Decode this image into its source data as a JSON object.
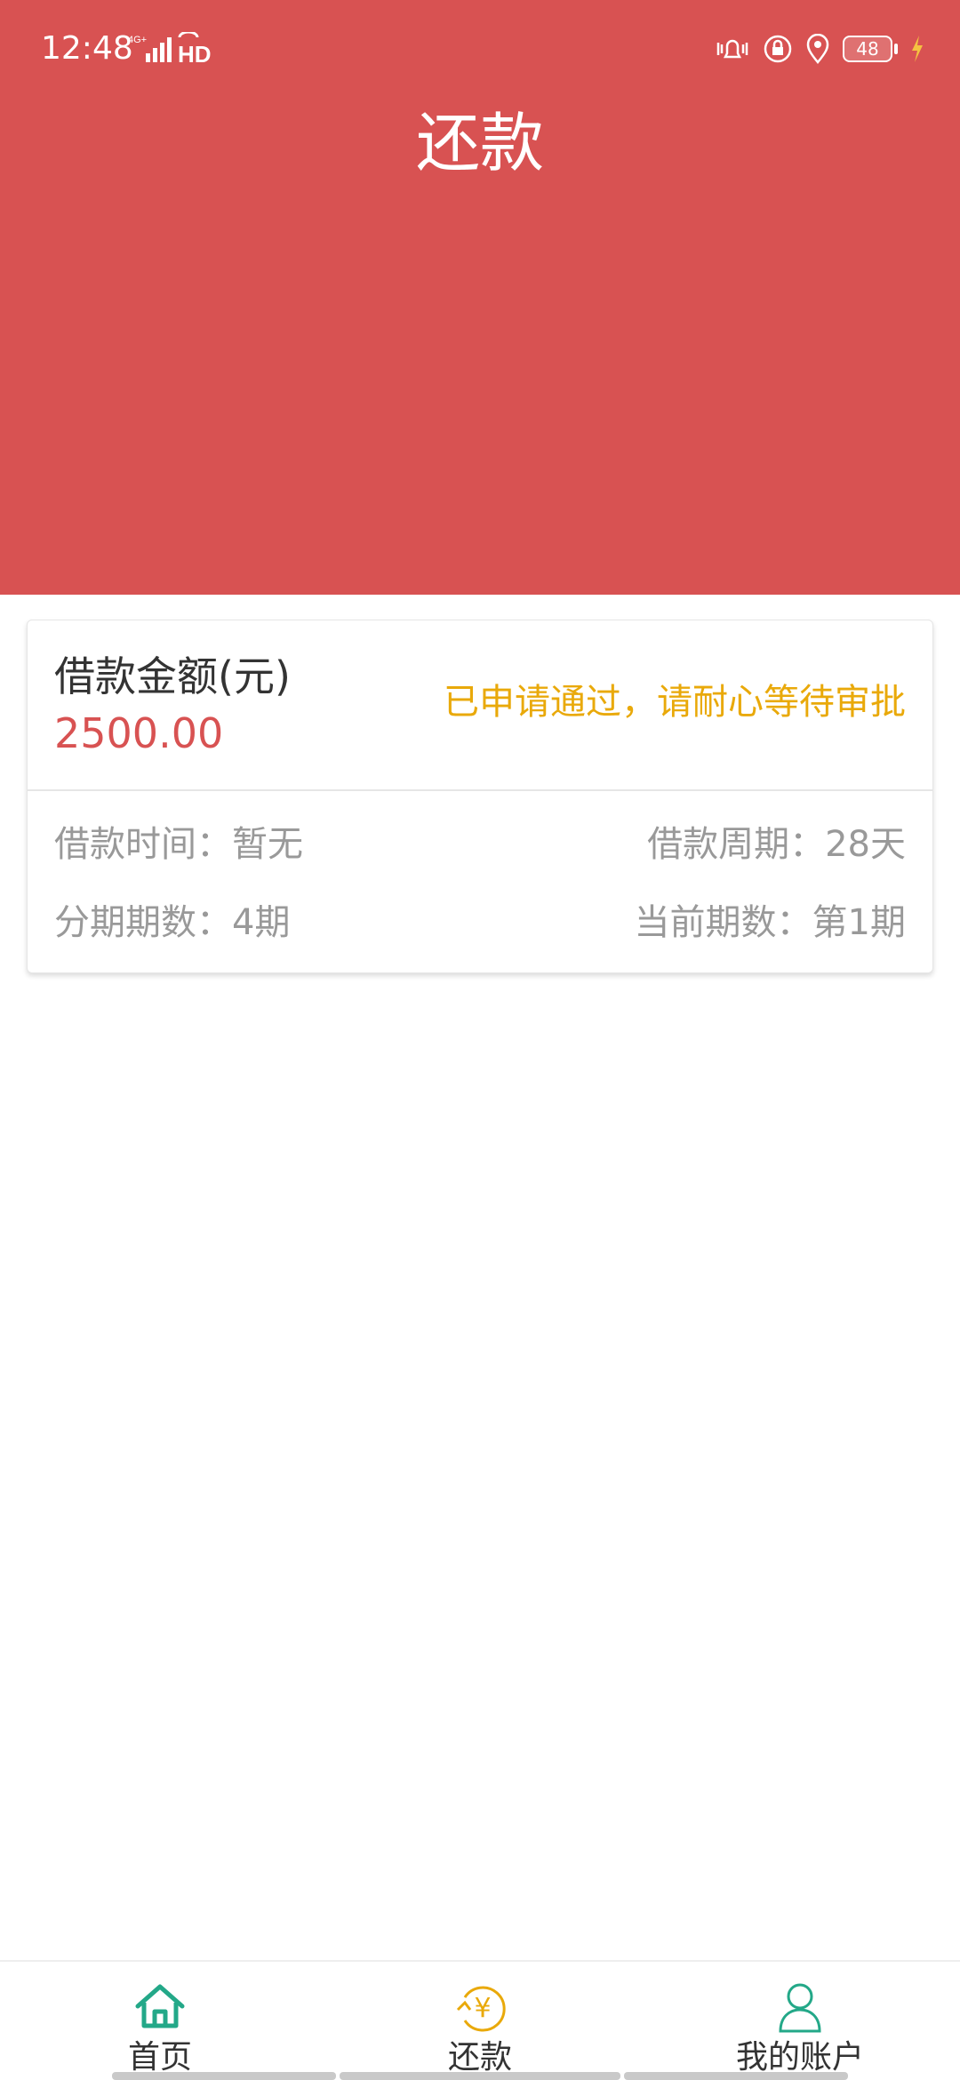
{
  "status_bar": {
    "time": "12:48",
    "network": "4G+",
    "hd_label": "HD",
    "battery": "48",
    "icons": [
      "signal-icon",
      "hd-icon",
      "vibrate-icon",
      "rotation-lock-icon",
      "location-icon",
      "battery-icon",
      "charging-icon"
    ]
  },
  "header": {
    "title": "还款",
    "color": "#d85252"
  },
  "loan_card": {
    "amount_label": "借款金额(元)",
    "amount_value": "2500.00",
    "status_text": "已申请通过，请耐心等待审批",
    "loan_time": "借款时间：暂无",
    "loan_period": "借款周期：28天",
    "installments": "分期期数：4期",
    "current_installment": "当前期数：第1期",
    "colors": {
      "amount": "#d85252",
      "status": "#e9a90a",
      "meta": "#999999"
    }
  },
  "tab_bar": {
    "tabs": [
      {
        "label": "首页",
        "icon": "home-icon"
      },
      {
        "label": "还款",
        "icon": "repay-yen-icon"
      },
      {
        "label": "我的账户",
        "icon": "user-icon"
      }
    ],
    "accent": "#23a888"
  }
}
